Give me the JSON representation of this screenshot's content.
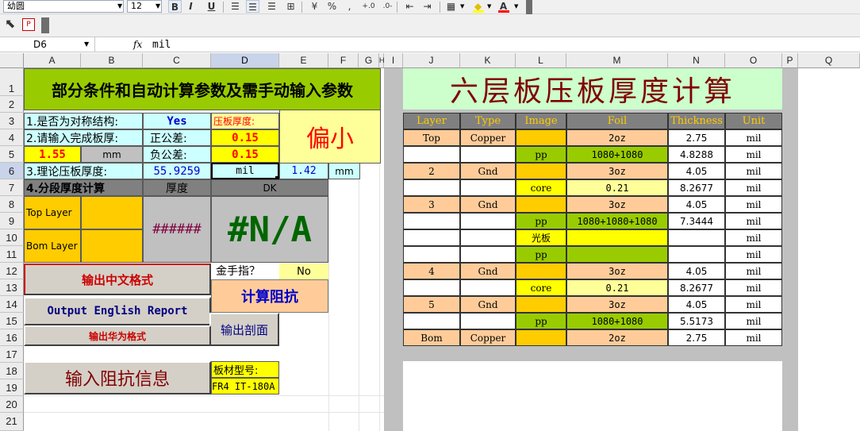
{
  "toolbar": {
    "font_name": "幼圆",
    "font_size": "12",
    "bold_label": "B",
    "italic_label": "I",
    "underline_label": "U",
    "percent_label": "%",
    "comma_label": ","
  },
  "formula_bar": {
    "name_box": "D6",
    "fx_label": "fx",
    "value": "mil"
  },
  "columns": [
    "A",
    "B",
    "C",
    "D",
    "E",
    "F",
    "G",
    "H",
    "I",
    "J",
    "K",
    "L",
    "M",
    "N",
    "O",
    "P",
    "Q"
  ],
  "rows": [
    "1",
    "2",
    "3",
    "4",
    "5",
    "6",
    "7",
    "8",
    "9",
    "10",
    "11",
    "12",
    "13",
    "14",
    "15",
    "16",
    "17",
    "18",
    "19",
    "20",
    "21"
  ],
  "left": {
    "banner": "部分条件和自动计算参数及需手动输入参数",
    "q1_label": "1.是否为对称结构:",
    "q1_value": "Yes",
    "press_thickness_label": "压板厚度:",
    "q2_label": "2.请输入完成板厚:",
    "pos_tol_label": "正公差:",
    "pos_tol_value": "0.15",
    "thickness_value": "1.55",
    "thickness_unit": "mm",
    "neg_tol_label": "负公差:",
    "neg_tol_value": "0.15",
    "bias_text": "偏小",
    "q3_label": "3.理论压板厚度:",
    "theory_value": "55.9259",
    "theory_unit": "mil",
    "theory_mm_value": "1.42",
    "theory_mm_unit": "mm",
    "q4_label": "4.分段厚度计算",
    "thickness_header": "厚度",
    "dk_header": "DK",
    "top_layer": "Top Layer",
    "bom_layer": "Bom Layer",
    "overflow_value": "######",
    "na_value": "#N/A",
    "btn_chinese": "输出中文格式",
    "gold_finger_label": "金手指？",
    "gold_finger_value": "No",
    "btn_impedance": "计算阻抗",
    "btn_english": "Output English Report",
    "btn_huawei": "输出华为格式",
    "btn_section": "输出剖面",
    "btn_input_impedance": "输入阻抗信息",
    "material_label": "板材型号:",
    "material_value": "FR4 IT-180A"
  },
  "right": {
    "title": "六层板压板厚度计算",
    "headers": [
      "Layer",
      "Type",
      "Image",
      "Foil",
      "Thickness",
      "Unit"
    ],
    "table": [
      {
        "layer": "Top",
        "type": "Copper",
        "image": "",
        "foil": "2oz",
        "thickness": "2.75",
        "unit": "mil"
      },
      {
        "layer": "",
        "type": "",
        "image": "pp",
        "foil": "1080+1080",
        "thickness": "4.8288",
        "unit": "mil"
      },
      {
        "layer": "2",
        "type": "Gnd",
        "image": "",
        "foil": "3oz",
        "thickness": "4.05",
        "unit": "mil"
      },
      {
        "layer": "",
        "type": "",
        "image": "core",
        "foil": "0.21",
        "thickness": "8.2677",
        "unit": "mil"
      },
      {
        "layer": "3",
        "type": "Gnd",
        "image": "",
        "foil": "3oz",
        "thickness": "4.05",
        "unit": "mil"
      },
      {
        "layer": "",
        "type": "",
        "image": "pp",
        "foil": "1080+1080+1080",
        "thickness": "7.3444",
        "unit": "mil"
      },
      {
        "layer": "",
        "type": "",
        "image": "光板",
        "foil": "",
        "thickness": "",
        "unit": "mil"
      },
      {
        "layer": "",
        "type": "",
        "image": "pp",
        "foil": "",
        "thickness": "",
        "unit": "mil"
      },
      {
        "layer": "4",
        "type": "Gnd",
        "image": "",
        "foil": "3oz",
        "thickness": "4.05",
        "unit": "mil"
      },
      {
        "layer": "",
        "type": "",
        "image": "core",
        "foil": "0.21",
        "thickness": "8.2677",
        "unit": "mil"
      },
      {
        "layer": "5",
        "type": "Gnd",
        "image": "",
        "foil": "3oz",
        "thickness": "4.05",
        "unit": "mil"
      },
      {
        "layer": "",
        "type": "",
        "image": "pp",
        "foil": "1080+1080",
        "thickness": "5.5173",
        "unit": "mil"
      },
      {
        "layer": "Bom",
        "type": "Copper",
        "image": "",
        "foil": "2oz",
        "thickness": "2.75",
        "unit": "mil"
      }
    ]
  },
  "colors": {
    "banner_green": "#99cc00",
    "title_green": "#ccffcc",
    "title_text": "#800000",
    "header_gray": "#808080",
    "header_text": "#ffcc00",
    "yellow": "#ffff00",
    "peach": "#ffcc99",
    "orange": "#ffcc00",
    "red_text": "#ff0000",
    "blue_text": "#0000cc"
  }
}
